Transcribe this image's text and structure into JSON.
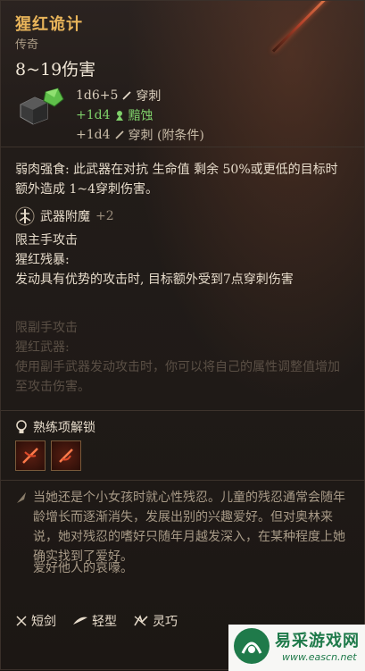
{
  "item": {
    "name": "猩红诡计",
    "rarity": "传奇",
    "damage": "8~19伤害",
    "damage_rows": [
      {
        "dice": "1d6+5",
        "type": "穿刺"
      },
      {
        "dice": "+1d4",
        "type": "黯蚀"
      },
      {
        "dice": "+1d4",
        "type": "穿刺 (附条件)"
      }
    ]
  },
  "passive": {
    "text": "弱肉强食: 此武器在对抗 生命值 剩余 50%或更低的目标时额外造成 1~4穿刺伤害。"
  },
  "enchant": {
    "name": "武器附魔",
    "level": "+2"
  },
  "restriction": "限主手攻击",
  "ability": {
    "name": "猩红残暴:",
    "desc": "发动具有优势的攻击时, 目标额外受到7点穿刺伤害"
  },
  "faded": {
    "line1": "限副手攻击",
    "line2": "猩红武器:",
    "line3": "使用副手武器发动攻击时，你可以将自己的属性调整值增加至攻击伤害。"
  },
  "proficiency": {
    "label": "熟练项解锁"
  },
  "lore": {
    "text": "当她还是个小女孩时就心性残忍。儿童的残忍通常会随年龄增长而逐渐消失，发展出别的兴趣爱好。但对奥林来说，她对残忍的嗜好只随年月越发深入，在某种程度上她确实找到了爱好。",
    "quote": "爱好他人的哀嚎。"
  },
  "tags": [
    "短剑",
    "轻型",
    "灵巧"
  ],
  "watermark": {
    "name": "易采游戏网",
    "url": "www.eascn.net"
  },
  "colors": {
    "title": "#e8b45a",
    "necrotic": "#7fd06a",
    "brand": "#1f7a4a"
  }
}
